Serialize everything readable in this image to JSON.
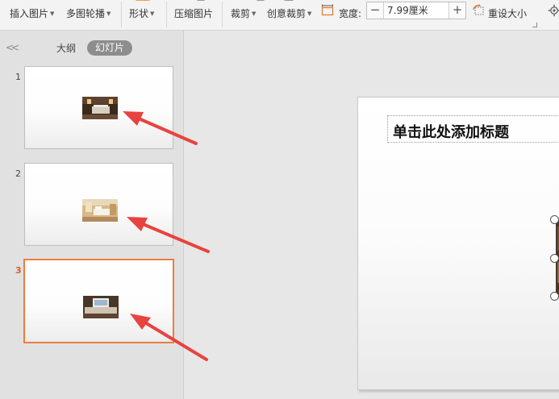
{
  "toolbar": {
    "insert_picture": "插入图片",
    "multi_carousel": "多图轮播",
    "shape": "形状",
    "compress_picture": "压缩图片",
    "crop": "裁剪",
    "creative_crop": "创意裁剪",
    "width_label": "宽度:",
    "width_value": "7.99厘米",
    "minus": "−",
    "plus": "+",
    "reset_size": "重设大小"
  },
  "panel": {
    "collapse_glyph": "<<",
    "tab_outline": "大纲",
    "tab_slides": "幻灯片",
    "slides": [
      {
        "number": "1",
        "selected": false
      },
      {
        "number": "2",
        "selected": false
      },
      {
        "number": "3",
        "selected": true
      }
    ]
  },
  "editor": {
    "title_placeholder": "单击此处添加标题"
  },
  "colors": {
    "selection_border": "#ef7b41",
    "annotation_arrow": "#e8433e",
    "selected_number": "#e05a2b"
  },
  "icons": [
    "crop-icon",
    "reset-size-icon",
    "gear-icon",
    "collapse-icon"
  ]
}
